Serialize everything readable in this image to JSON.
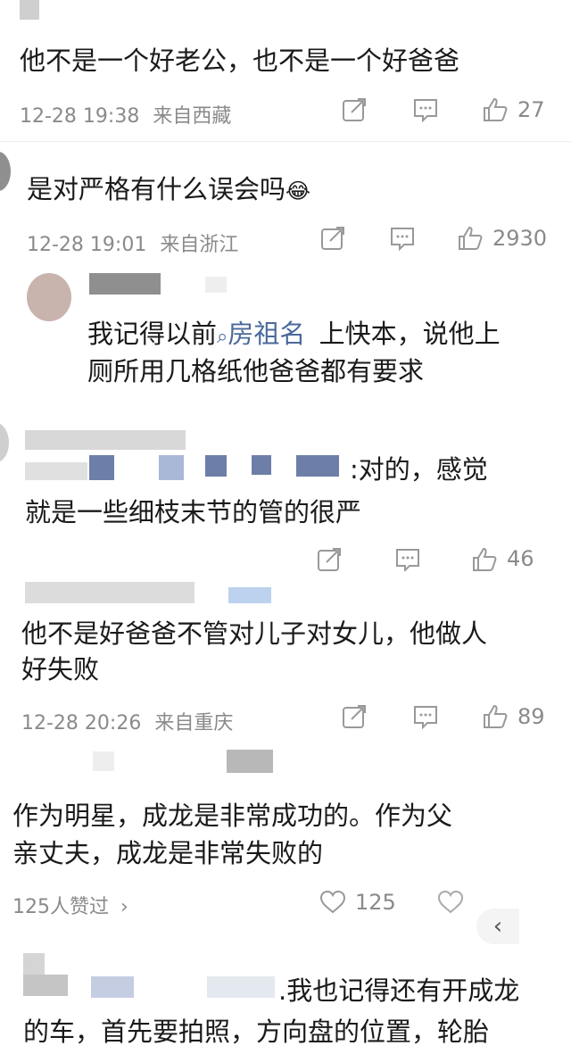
{
  "comments": [
    {
      "text": "他不是一个好老公，也不是一个好爸爸",
      "date": "12-28 19:38",
      "location": "来自西藏",
      "likes": "27"
    },
    {
      "text": "是对严格有什么误会吗",
      "emoji": "😂",
      "date": "12-28 19:01",
      "location": "来自浙江",
      "likes": "2930",
      "reply": {
        "prefix": "我记得以前",
        "mention": "房祖名",
        "rest_line1": "上快本，说他上",
        "line2": "厕所用几格纸他爸爸都有要求"
      }
    },
    {
      "text_line1_suffix": ":对的，感觉",
      "text_line2": "就是一些细枝末节的管的很严",
      "likes": "46"
    },
    {
      "text_line1": "他不是好爸爸不管对儿子对女儿，他做人",
      "text_line2": "好失败",
      "date": "12-28 20:26",
      "location": "来自重庆",
      "likes": "89"
    },
    {
      "text_line1": "作为明星，成龙是非常成功的。作为父",
      "text_line2": "亲丈夫，成龙是非常失败的",
      "liked_by": "125人赞过",
      "heart_count": "125"
    },
    {
      "text_line1_suffix": ".我也记得还有开成龙",
      "text_line2": "的车，首先要拍照，方向盘的位置，轮胎"
    }
  ],
  "icons": {
    "share": "share-icon",
    "comment": "comment-icon",
    "like": "thumbs-up-icon",
    "heart": "heart-icon",
    "back": "chevron-left-icon"
  },
  "colors": {
    "mention": "#4a6a9a",
    "meta": "#8a8a8a"
  }
}
